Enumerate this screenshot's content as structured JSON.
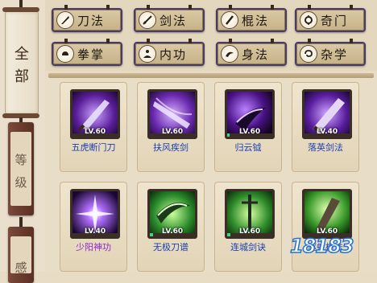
{
  "left_tabs": {
    "all": [
      "全",
      "部"
    ],
    "rank": [
      "等",
      "级"
    ],
    "feeling": "感"
  },
  "categories": [
    {
      "label": "刀法",
      "icon": "blade-icon"
    },
    {
      "label": "剑法",
      "icon": "sword-icon"
    },
    {
      "label": "棍法",
      "icon": "staff-icon"
    },
    {
      "label": "奇门",
      "icon": "hidden-weapon-icon"
    },
    {
      "label": "拳掌",
      "icon": "fist-icon"
    },
    {
      "label": "内功",
      "icon": "meditation-icon"
    },
    {
      "label": "身法",
      "icon": "movement-icon"
    },
    {
      "label": "杂学",
      "icon": "misc-icon"
    }
  ],
  "skills": [
    {
      "name": "五虎断门刀",
      "level": "LV.60",
      "progress": 0,
      "quality": "blue",
      "icon": "saber-icon"
    },
    {
      "name": "扶风疾剑",
      "level": "LV.60",
      "progress": 0,
      "quality": "blue",
      "icon": "sword-slash-icon"
    },
    {
      "name": "归云钺",
      "level": "LV.60",
      "progress": 0.05,
      "quality": "blue",
      "icon": "axe-icon"
    },
    {
      "name": "落英剑法",
      "level": "LV.40",
      "progress": 0,
      "quality": "blue",
      "icon": "greatsword-icon"
    },
    {
      "name": "少阳神功",
      "level": "LV.40",
      "progress": 0,
      "quality": "purple",
      "icon": "burst-icon"
    },
    {
      "name": "无极刀谱",
      "level": "LV.60",
      "progress": 0.07,
      "quality": "blue",
      "icon": "green-blade-icon"
    },
    {
      "name": "连城剑诀",
      "level": "LV.60",
      "progress": 0.07,
      "quality": "blue",
      "icon": "green-sword-icon"
    },
    {
      "name": "驱虹棍法",
      "level": "LV.60",
      "progress": 0,
      "quality": "blue",
      "icon": "club-icon"
    }
  ],
  "watermark": "18183",
  "colors": {
    "blue_name": "#1a3fb0",
    "purple_name": "#8c2bc8",
    "progress_fill": "#4ed07a",
    "button_border": "#4a3a66"
  }
}
